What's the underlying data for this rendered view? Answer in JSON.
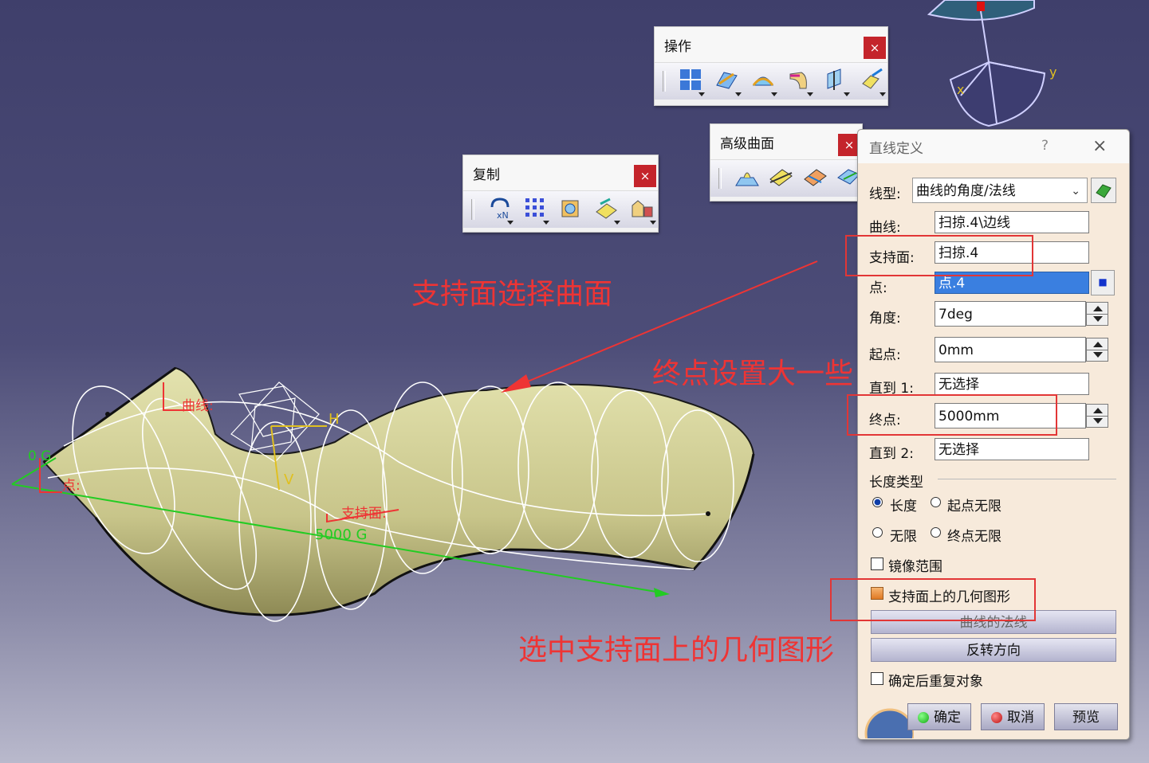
{
  "colors": {
    "annotation": "#ee3434",
    "surface": "#d8d69a",
    "viewport_top": "#3f3f6b"
  },
  "toolbars": {
    "operation": {
      "title": "操作",
      "close": "×",
      "icons": [
        "join-icon",
        "healing-icon",
        "boundary-icon",
        "fillet-icon",
        "split-icon",
        "translate-icon"
      ]
    },
    "advanced_surface": {
      "title": "高级曲面",
      "close": "×",
      "icons": [
        "bump-icon",
        "wrap-curve-icon",
        "wrap-surface-icon",
        "shape-morphing-icon"
      ]
    },
    "copy": {
      "title": "复制",
      "close": "×",
      "icons": [
        "object-repetition-icon",
        "rectangular-pattern-icon",
        "power-copy-icon",
        "save-powercopy-icon",
        "catalog-icon"
      ]
    }
  },
  "scene_labels": {
    "curve": "曲线:",
    "support": "支持面:",
    "point": "点:",
    "angle0": "0 G",
    "length": "5000 G",
    "axis_h": "H",
    "axis_v": "V",
    "axis_x": "x",
    "axis_y": "y"
  },
  "annotations": {
    "support_surface": "支持面选择曲面",
    "end_point": "终点设置大一些",
    "geometry_on_support": "选中支持面上的几何图形"
  },
  "dialog": {
    "title": "直线定义",
    "help": "?",
    "close": "×",
    "line_type_label": "线型:",
    "line_type_value": "曲线的角度/法线",
    "curve_label": "曲线:",
    "curve_value": "扫掠.4\\边线",
    "support_label": "支持面:",
    "support_value": "扫掠.4",
    "point_label": "点:",
    "point_value": "点.4",
    "angle_label": "角度:",
    "angle_value": "7deg",
    "start_label": "起点:",
    "start_value": "0mm",
    "upto1_label": "直到 1:",
    "upto1_value": "无选择",
    "end_label": "终点:",
    "end_value": "5000mm",
    "upto2_label": "直到 2:",
    "upto2_value": "无选择",
    "length_type_label": "长度类型",
    "length_type_options": [
      {
        "label": "长度",
        "selected": true
      },
      {
        "label": "起点无限",
        "selected": false
      },
      {
        "label": "无限",
        "selected": false
      },
      {
        "label": "终点无限",
        "selected": false
      }
    ],
    "mirror_label": "镜像范围",
    "mirror_checked": false,
    "geometry_on_support_label": "支持面上的几何图形",
    "geometry_on_support_checked": true,
    "normal_button": "曲线的法线",
    "reverse_button": "反转方向",
    "repeat_label": "确定后重复对象",
    "repeat_checked": false,
    "ok_button": "确定",
    "cancel_button": "取消",
    "preview_button": "预览"
  }
}
